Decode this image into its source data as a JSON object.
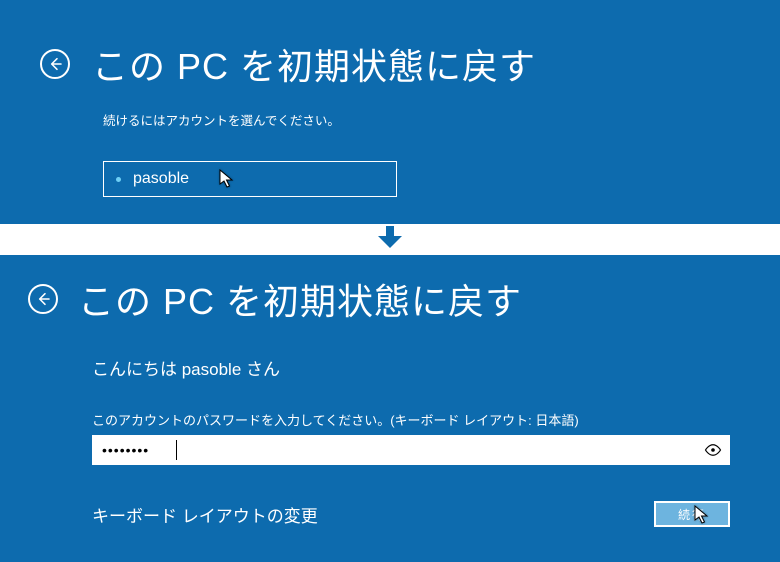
{
  "top": {
    "title": "この PC を初期状態に戻す",
    "subtitle": "続けるにはアカウントを選んでください。",
    "account_name": "pasoble"
  },
  "bottom": {
    "title": "この PC を初期状態に戻す",
    "greeting": "こんにちは pasoble さん",
    "instruction": "このアカウントのパスワードを入力してください。(キーボード レイアウト: 日本語)",
    "password_value": "••••••••",
    "keyboard_link": "キーボード レイアウトの変更",
    "continue_label": "続行"
  }
}
